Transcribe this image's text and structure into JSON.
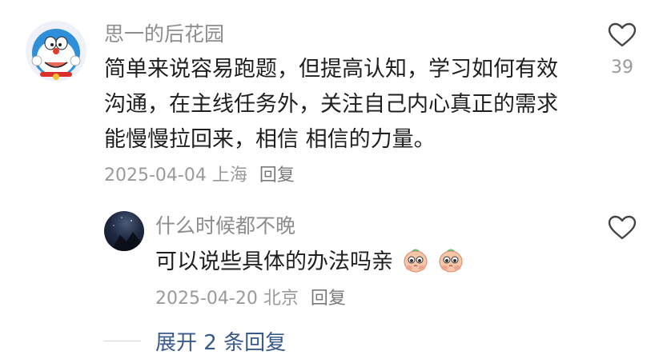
{
  "comment": {
    "username": "思一的后花园",
    "lines": [
      "简单来说容易跑题，但提高认知，学习如何有效",
      "沟通，在主线任务外，关注自己内心真正的需求",
      "能慢慢拉回来，相信 相信的力量。"
    ],
    "date": "2025-04-04",
    "location": "上海",
    "reply_label": "回复",
    "like_count": "39"
  },
  "reply": {
    "username": "什么时候都不晚",
    "text": "可以说些具体的办法吗亲",
    "emojis": [
      "pleading-face-emoji",
      "pleading-face-emoji"
    ],
    "date": "2025-04-20",
    "location": "北京",
    "reply_label": "回复"
  },
  "expand": {
    "label": "展开 2 条回复"
  },
  "colors": {
    "username": "#8d8d8d",
    "meta": "#9a9a9a",
    "expand_link": "#3a5a8c"
  }
}
